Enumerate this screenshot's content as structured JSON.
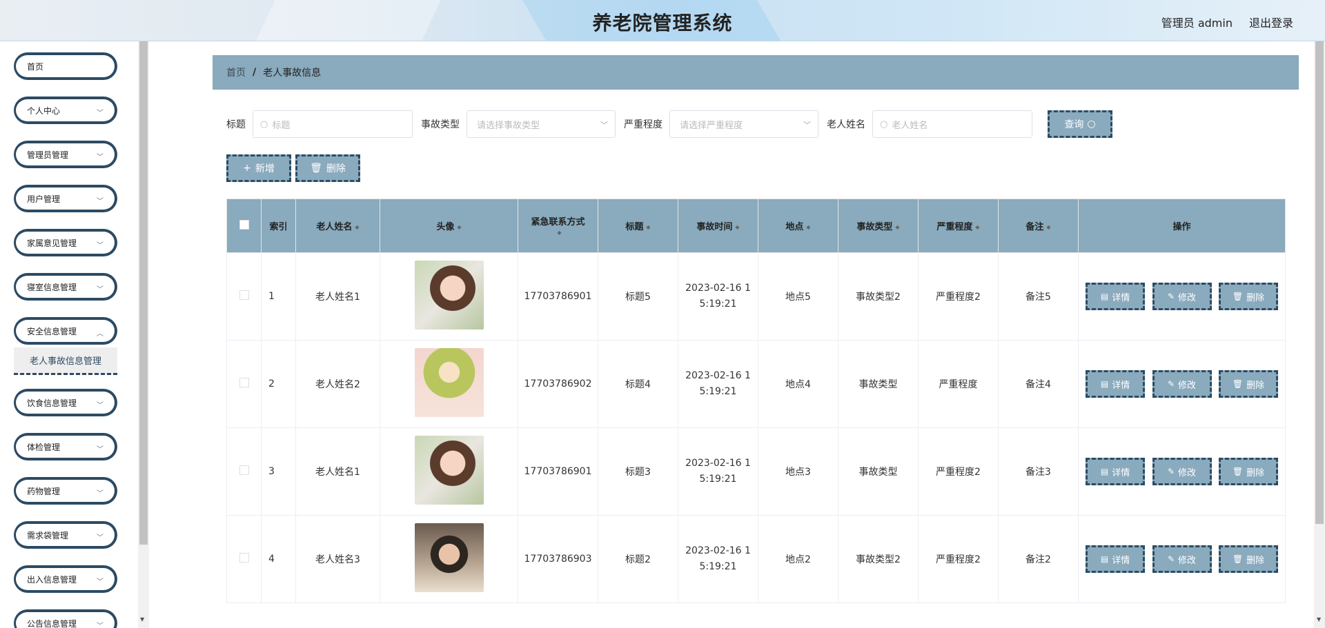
{
  "header": {
    "title": "养老院管理系统",
    "user": "管理员 admin",
    "logout": "退出登录"
  },
  "sidebar": {
    "items": [
      {
        "label": "首页",
        "top": 0
      },
      {
        "label": "个人中心"
      },
      {
        "label": "管理员管理"
      },
      {
        "label": "用户管理"
      },
      {
        "label": "家属意见管理"
      },
      {
        "label": "寝室信息管理"
      },
      {
        "label": "安全信息管理"
      },
      {
        "label": "饮食信息管理"
      },
      {
        "label": "体检管理"
      },
      {
        "label": "药物管理"
      },
      {
        "label": "需求袋管理"
      },
      {
        "label": "出入信息管理"
      },
      {
        "label": "公告信息管理"
      }
    ],
    "active_sub": "老人事故信息管理"
  },
  "breadcrumb": {
    "home": "首页",
    "current": "老人事故信息"
  },
  "search": {
    "title_label": "标题",
    "title_placeholder": "标题",
    "type_label": "事故类型",
    "type_placeholder": "请选择事故类型",
    "severity_label": "严重程度",
    "severity_placeholder": "请选择严重程度",
    "name_label": "老人姓名",
    "name_placeholder": "老人姓名",
    "query_label": "查询"
  },
  "actions": {
    "add_label": "新增",
    "delete_label": "删除"
  },
  "table": {
    "headers": [
      "索引",
      "老人姓名",
      "头像",
      "紧急联系方式",
      "标题",
      "事故时间",
      "地点",
      "事故类型",
      "严重程度",
      "备注",
      "操作"
    ],
    "op_labels": {
      "detail": "详情",
      "edit": "修改",
      "delete": "删除"
    },
    "rows": [
      {
        "index": "1",
        "name": "老人姓名1",
        "avatar": "girl1",
        "phone": "17703786901",
        "title": "标题5",
        "time1": "2023-02-16 1",
        "time2": "5:19:21",
        "place": "地点5",
        "type": "事故类型2",
        "severity": "严重程度2",
        "note": "备注5"
      },
      {
        "index": "2",
        "name": "老人姓名2",
        "avatar": "girl2",
        "phone": "17703786902",
        "title": "标题4",
        "time1": "2023-02-16 1",
        "time2": "5:19:21",
        "place": "地点4",
        "type": "事故类型",
        "severity": "严重程度",
        "note": "备注4"
      },
      {
        "index": "3",
        "name": "老人姓名1",
        "avatar": "girl1",
        "phone": "17703786901",
        "title": "标题3",
        "time1": "2023-02-16 1",
        "time2": "5:19:21",
        "place": "地点3",
        "type": "事故类型",
        "severity": "严重程度2",
        "note": "备注3"
      },
      {
        "index": "4",
        "name": "老人姓名3",
        "avatar": "boy",
        "phone": "17703786903",
        "title": "标题2",
        "time1": "2023-02-16 1",
        "time2": "5:19:21",
        "place": "地点2",
        "type": "事故类型2",
        "severity": "严重程度2",
        "note": "备注2"
      }
    ]
  },
  "icons": {
    "dropdown": "chevron-down-icon",
    "search": "search-icon",
    "add": "plus-icon",
    "trash": "trash-icon",
    "detail": "document-icon",
    "edit": "pencil-icon",
    "sort": "sort-icon"
  },
  "colors": {
    "accent": "#8aaabd",
    "border_dark": "#2c4a63"
  }
}
